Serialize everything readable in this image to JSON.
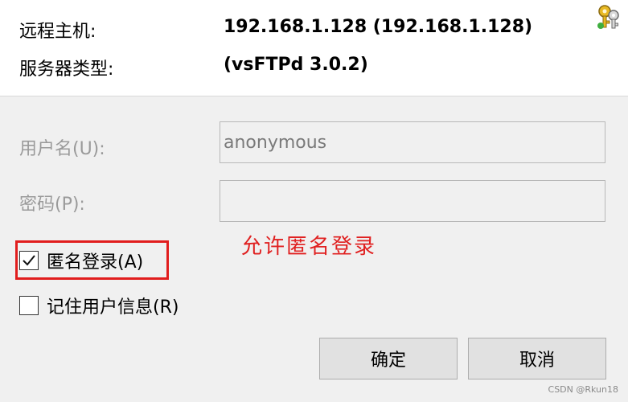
{
  "info": {
    "remote_host_label": "远程主机:",
    "remote_host_value": "192.168.1.128 (192.168.1.128)",
    "server_type_label": "服务器类型:",
    "server_type_value": "(vsFTPd 3.0.2)"
  },
  "form": {
    "username_label": "用户名(U):",
    "username_value": "anonymous",
    "password_label": "密码(P):",
    "password_value": ""
  },
  "options": {
    "anonymous_label": "匿名登录(A)",
    "anonymous_checked": true,
    "remember_label": "记住用户信息(R)",
    "remember_checked": false
  },
  "annotation": {
    "text": "允许匿名登录",
    "color": "#e02020"
  },
  "buttons": {
    "ok_label": "确定",
    "cancel_label": "取消"
  },
  "watermark": "CSDN @Rkun18",
  "icons": {
    "header_icon": "keys-icon"
  }
}
